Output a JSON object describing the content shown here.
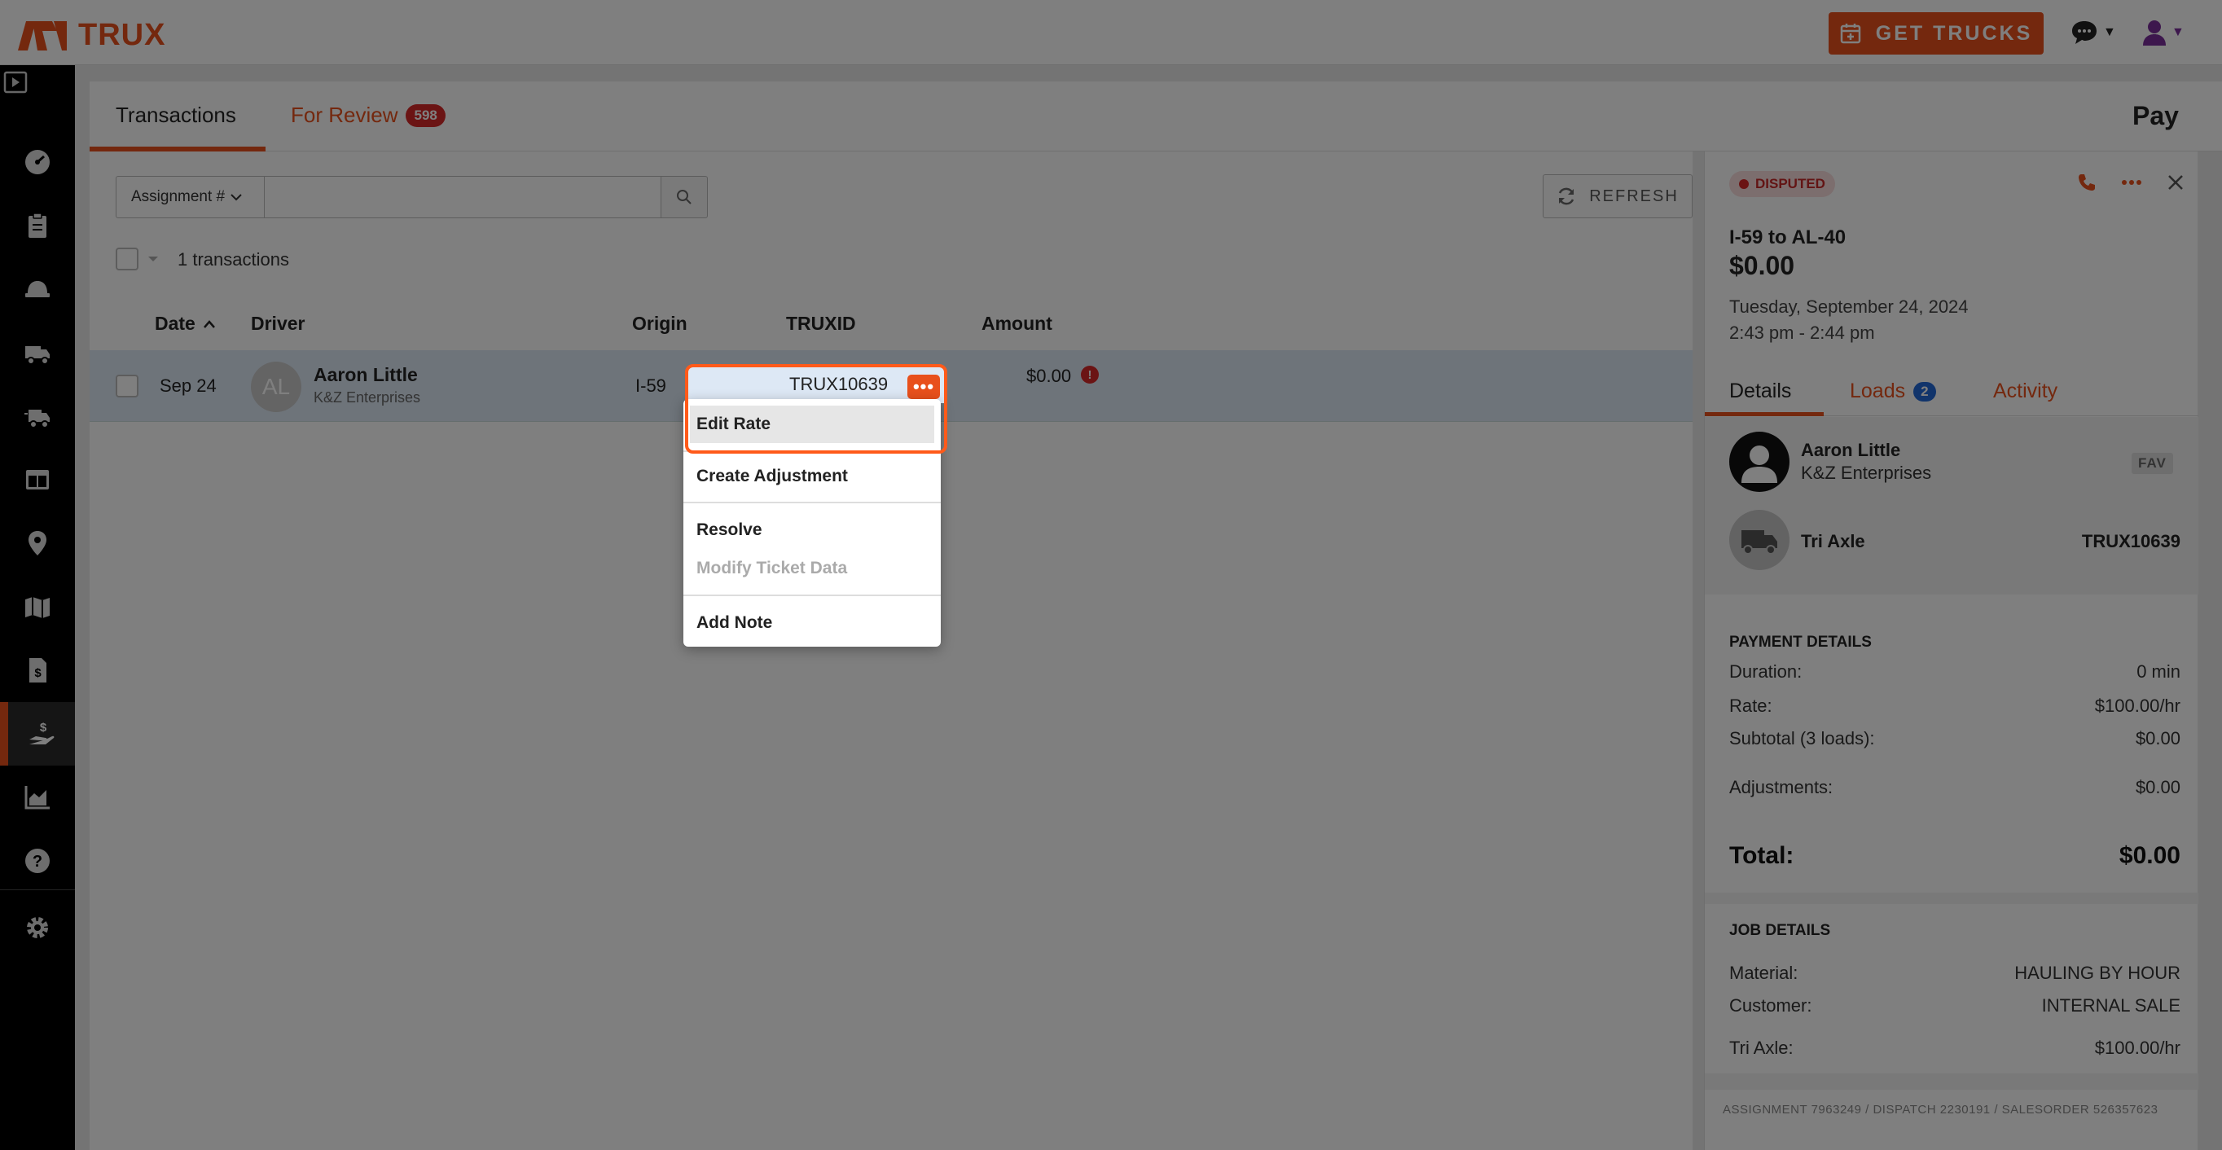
{
  "topbar": {
    "brand": "TRUX",
    "get_trucks_label": "GET TRUCKS",
    "colors": {
      "accent": "#e8501c",
      "user_icon": "#7a2f9a"
    }
  },
  "sidenav": {
    "items": [
      {
        "icon": "dashboard-icon"
      },
      {
        "icon": "clipboard-icon"
      },
      {
        "icon": "hardhat-icon"
      },
      {
        "icon": "truck-icon"
      },
      {
        "icon": "truck-fast-icon"
      },
      {
        "icon": "layout-icon"
      },
      {
        "icon": "map-pin-icon"
      },
      {
        "icon": "map-icon"
      },
      {
        "icon": "invoice-icon"
      },
      {
        "icon": "pay-hand-icon",
        "active": true
      },
      {
        "icon": "chart-icon"
      },
      {
        "icon": "help-icon"
      },
      {
        "icon": "settings-icon"
      }
    ]
  },
  "tabs": {
    "transactions": "Transactions",
    "for_review": "For Review",
    "for_review_count": "598",
    "page_title": "Pay"
  },
  "filters": {
    "select_value": "Assignment #",
    "search_value": "",
    "refresh_label": "REFRESH"
  },
  "list": {
    "count_text": "1 transactions",
    "columns": {
      "date": "Date",
      "driver": "Driver",
      "origin": "Origin",
      "truxid": "TRUXID",
      "amount": "Amount"
    },
    "rows": [
      {
        "date": "Sep 24",
        "initials": "AL",
        "driver_name": "Aaron Little",
        "driver_company": "K&Z Enterprises",
        "origin": "I-59",
        "truxid": "TRUX10639",
        "amount": "$0.00"
      }
    ]
  },
  "menu": {
    "items": [
      "Edit Rate",
      "Create Adjustment",
      "Resolve",
      "Modify Ticket Data",
      "Add Note"
    ],
    "disabled": [
      "Modify Ticket Data"
    ]
  },
  "panel": {
    "status": "DISPUTED",
    "title": "I-59 to AL-40",
    "amount": "$0.00",
    "date": "Tuesday, September 24, 2024",
    "time": "2:43 pm - 2:44 pm",
    "tabs": {
      "details": "Details",
      "loads": "Loads",
      "loads_count": "2",
      "activity": "Activity"
    },
    "driver_name": "Aaron Little",
    "driver_company": "K&Z Enterprises",
    "fav": "FAV",
    "truck_type": "Tri Axle",
    "truck_id": "TRUX10639",
    "payment": {
      "title": "PAYMENT DETAILS",
      "duration_label": "Duration:",
      "duration": "0 min",
      "rate_label": "Rate:",
      "rate": "$100.00/hr",
      "subtotal_label": "Subtotal (3 loads):",
      "subtotal": "$0.00",
      "adjustments_label": "Adjustments:",
      "adjustments": "$0.00",
      "total_label": "Total:",
      "total": "$0.00"
    },
    "job": {
      "title": "JOB DETAILS",
      "material_label": "Material:",
      "material": "HAULING BY HOUR",
      "customer_label": "Customer:",
      "customer": "INTERNAL SALE",
      "triaxle_label": "Tri Axle:",
      "triaxle": "$100.00/hr"
    },
    "footer": "ASSIGNMENT 7963249 / DISPATCH 2230191 / SALESORDER 526357623"
  }
}
